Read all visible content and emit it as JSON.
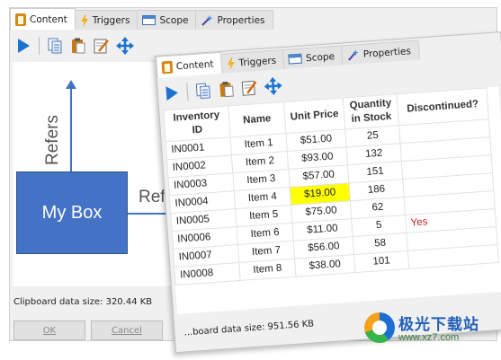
{
  "back_window": {
    "tabs": [
      {
        "label": "Content",
        "icon": "clipboard-icon",
        "active": true
      },
      {
        "label": "Triggers",
        "icon": "lightning-icon",
        "active": false
      },
      {
        "label": "Scope",
        "icon": "window-icon",
        "active": false
      },
      {
        "label": "Properties",
        "icon": "wand-icon",
        "active": false
      }
    ],
    "canvas": {
      "box_label": "My Box",
      "vertical_label": "Refers",
      "horizontal_label": "Ref"
    },
    "clipboard_size": "Clipboard data size: 320.44 KB",
    "ok_label": "OK",
    "cancel_label": "Cancel"
  },
  "front_window": {
    "tabs": [
      {
        "label": "Content",
        "icon": "clipboard-icon",
        "active": true
      },
      {
        "label": "Triggers",
        "icon": "lightning-icon",
        "active": false
      },
      {
        "label": "Scope",
        "icon": "window-icon",
        "active": false
      },
      {
        "label": "Properties",
        "icon": "wand-icon",
        "active": false
      }
    ],
    "table": {
      "headers": [
        "Inventory ID",
        "Name",
        "Unit Price",
        "Quantity in Stock",
        "Discontinued?"
      ],
      "rows": [
        [
          "IN0001",
          "Item 1",
          "$51.00",
          "25",
          ""
        ],
        [
          "IN0002",
          "Item 2",
          "$93.00",
          "132",
          ""
        ],
        [
          "IN0003",
          "Item 3",
          "$57.00",
          "151",
          ""
        ],
        [
          "IN0004",
          "Item 4",
          "$19.00",
          "186",
          ""
        ],
        [
          "IN0005",
          "Item 5",
          "$75.00",
          "62",
          ""
        ],
        [
          "IN0006",
          "Item 6",
          "$11.00",
          "5",
          "Yes"
        ],
        [
          "IN0007",
          "Item 7",
          "$56.00",
          "58",
          ""
        ],
        [
          "IN0008",
          "Item 8",
          "$38.00",
          "101",
          ""
        ]
      ],
      "highlight_color": "#ffff00",
      "yes_color": "#d02020"
    },
    "clipboard_size": "...board data size: 951.56 KB"
  },
  "toolbar_icons": [
    "play-icon",
    "copy-icon",
    "paste-icon",
    "edit-icon",
    "move-icon"
  ],
  "watermark": {
    "text": "极光下载站",
    "url": "www.xz7.com"
  },
  "colors": {
    "accent_blue": "#4472c4",
    "toolbar_blue": "#1a73d1"
  }
}
